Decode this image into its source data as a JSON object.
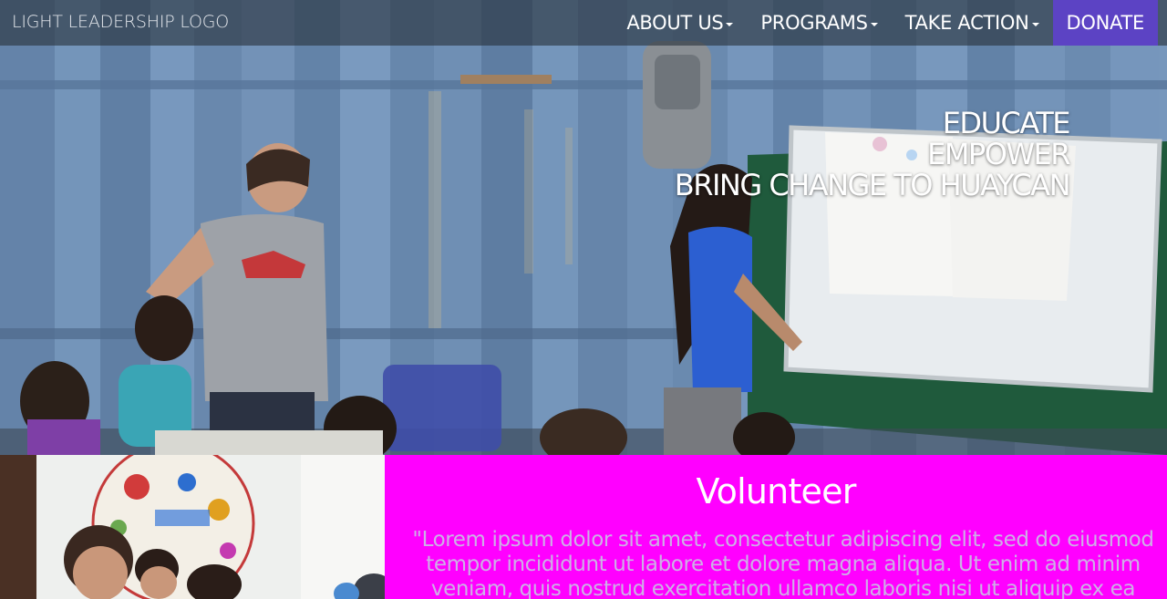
{
  "nav": {
    "brand": "LIGHT LEADERSHIP LOGO",
    "items": [
      {
        "label": "ABOUT US",
        "dropdown": true
      },
      {
        "label": "PROGRAMS",
        "dropdown": true
      },
      {
        "label": "TAKE ACTION",
        "dropdown": true
      }
    ],
    "donate": "DONATE"
  },
  "hero": {
    "lines": [
      "EDUCATE",
      "EMPOWER",
      "BRING CHANGE TO HUAYCAN"
    ]
  },
  "volunteer": {
    "title": "Volunteer",
    "text": "\"Lorem ipsum dolor sit amet, consectetur adipiscing elit, sed do eiusmod tempor incididunt ut labore et dolore magna aliqua. Ut enim ad minim veniam, quis nostrud exercitation ullamco laboris nisi ut aliquip ex ea commodo consequat."
  },
  "colors": {
    "navbar": "#2b3540",
    "donate": "#5c43c4",
    "volunteer_bg": "#ff00ff",
    "volunteer_text": "#cdb0e6"
  }
}
